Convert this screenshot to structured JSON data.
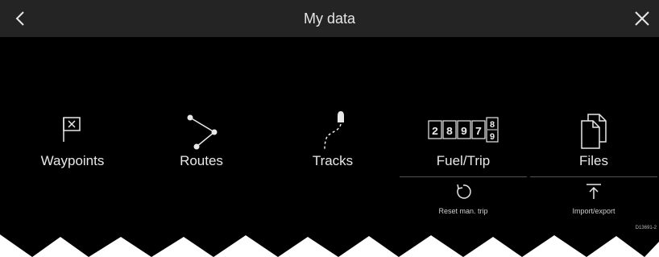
{
  "header": {
    "title": "My data",
    "back_icon": "chevron-left-icon",
    "close_icon": "close-icon"
  },
  "tiles": [
    {
      "label": "Waypoints",
      "icon": "waypoint-flag-icon"
    },
    {
      "label": "Routes",
      "icon": "route-icon"
    },
    {
      "label": "Tracks",
      "icon": "track-icon"
    },
    {
      "label": "Fuel/Trip",
      "icon": "odometer-icon",
      "odometer_digits": [
        "2",
        "8",
        "9",
        "7"
      ],
      "odometer_rolling": [
        "8",
        "9"
      ]
    },
    {
      "label": "Files",
      "icon": "files-icon"
    }
  ],
  "sub_actions": {
    "reset": {
      "label": "Reset man. trip",
      "icon": "reset-icon"
    },
    "import_export": {
      "label": "Import/export",
      "icon": "upload-icon"
    }
  },
  "diagram_id": "D13691-2",
  "colors": {
    "screen_bg": "#000000",
    "titlebar_bg": "#242424",
    "text": "#e8e8e8",
    "divider": "#555555"
  }
}
